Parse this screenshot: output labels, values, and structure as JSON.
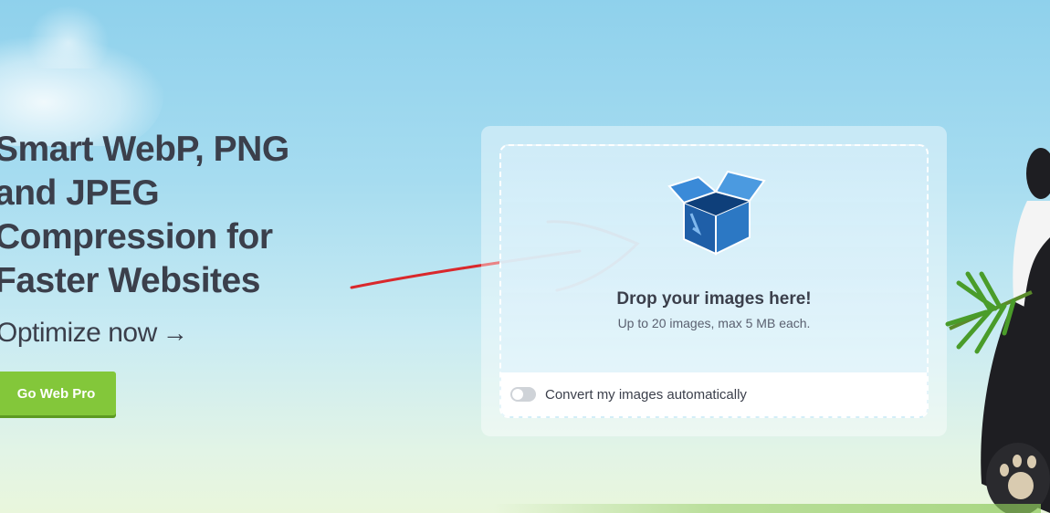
{
  "hero": {
    "title": "Smart WebP, PNG\nand JPEG\nCompression for\nFaster Websites",
    "optimize_label": "Optimize now",
    "optimize_arrow": "→",
    "cta_label": "Go Web Pro"
  },
  "uploader": {
    "drop_title": "Drop your images here!",
    "drop_subtitle": "Up to 20 images, max 5 MB each.",
    "convert_label": "Convert my images automatically",
    "convert_enabled": false
  },
  "colors": {
    "cta": "#83c73a",
    "annotation": "#d9282c",
    "text": "#3b3f4b"
  },
  "icons": [
    "box-icon",
    "arrow-right-icon",
    "toggle-icon"
  ]
}
